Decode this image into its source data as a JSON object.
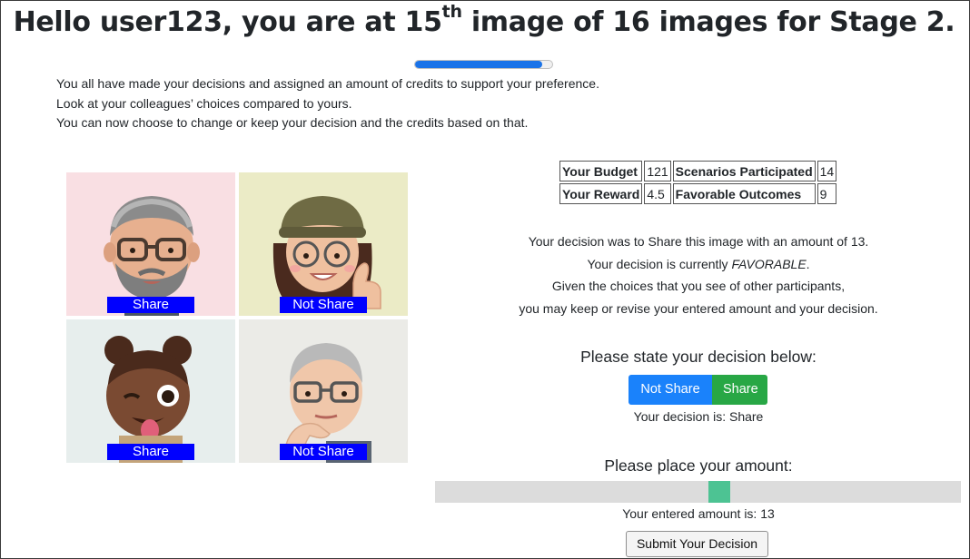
{
  "header": {
    "title_prefix": "Hello user123, you are at 15",
    "title_sup": "th",
    "title_suffix": " image of 16 images for Stage 2.",
    "progress_fraction": 0.93
  },
  "intro": [
    "You all have made your decisions and assigned an amount of credits to support your preference.",
    "Look at your colleagues’ choices compared to yours.",
    "You can now choose to change or keep your decision and the credits based on that."
  ],
  "participants": [
    {
      "label": "Share",
      "bg": "#f9dfe3",
      "avatar": "bearded-man-with-glasses-avatar"
    },
    {
      "label": "Not Share",
      "bg": "#ebebc6",
      "avatar": "woman-with-beanie-thumbs-up-avatar"
    },
    {
      "label": "Share",
      "bg": "#e7eeed",
      "avatar": "girl-winking-tongue-out-avatar"
    },
    {
      "label": "Not Share",
      "bg": "#ebebe7",
      "avatar": "older-man-thinking-avatar"
    }
  ],
  "stats": {
    "budget_label": "Your Budget",
    "budget_value": "121",
    "scenarios_label": "Scenarios Participated",
    "scenarios_value": "14",
    "reward_label": "Your Reward",
    "reward_value": "4.5",
    "favorable_label": "Favorable Outcomes",
    "favorable_value": "9"
  },
  "message": {
    "line1": "Your decision was to Share this image with an amount of 13.",
    "line2_prefix": "Your decision is currently ",
    "line2_status": "FAVORABLE",
    "line2_suffix": ".",
    "line3": "Given the choices that you see of other participants,",
    "line4": "you may keep or revise your entered amount and your decision."
  },
  "decision": {
    "title": "Please state your decision below:",
    "not_share_label": "Not Share",
    "share_label": "Share",
    "current": "Your decision is: Share"
  },
  "amount": {
    "title": "Please place your amount:",
    "value": 13,
    "min": 0,
    "max": 24,
    "entered": "Your entered amount is: 13",
    "submit_label": "Submit Your Decision"
  },
  "colors": {
    "accent_blue": "#1a82fb",
    "accent_green": "#28a745",
    "slider_thumb": "#4dc393",
    "label_blue": "#0000ff"
  }
}
